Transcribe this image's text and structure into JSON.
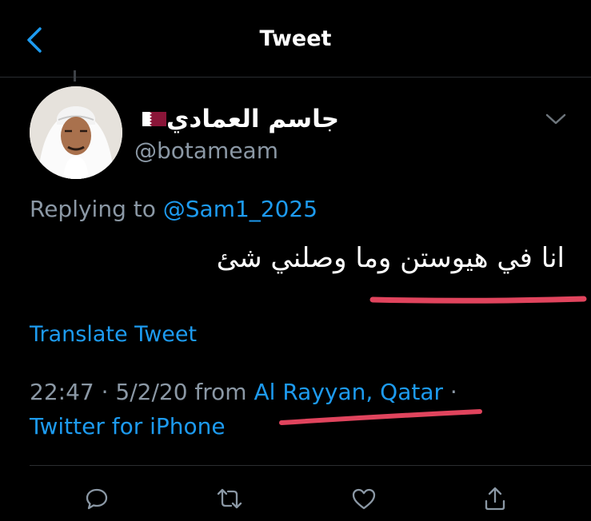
{
  "nav": {
    "title": "Tweet"
  },
  "tweet": {
    "display_name": "جاسم العمادي",
    "handle": "@botameam",
    "replying_prefix": "Replying to",
    "replying_to": "@Sam1_2025",
    "text": "انا في هيوستن وما وصلني شئ",
    "translate_label": "Translate Tweet",
    "time_date": "22:47 · 5/2/20 from",
    "location": "Al Rayyan, Qatar",
    "separator": "·",
    "source": "Twitter for iPhone"
  },
  "colors": {
    "background": "#000000",
    "link": "#1d9bf0",
    "secondary_text": "#8b98a5",
    "annotation": "#e0445d"
  },
  "icons": {
    "back": "chevron-left-icon",
    "more": "chevron-down-icon",
    "reply": "comment-icon",
    "retweet": "retweet-icon",
    "like": "heart-icon",
    "share": "share-icon"
  }
}
